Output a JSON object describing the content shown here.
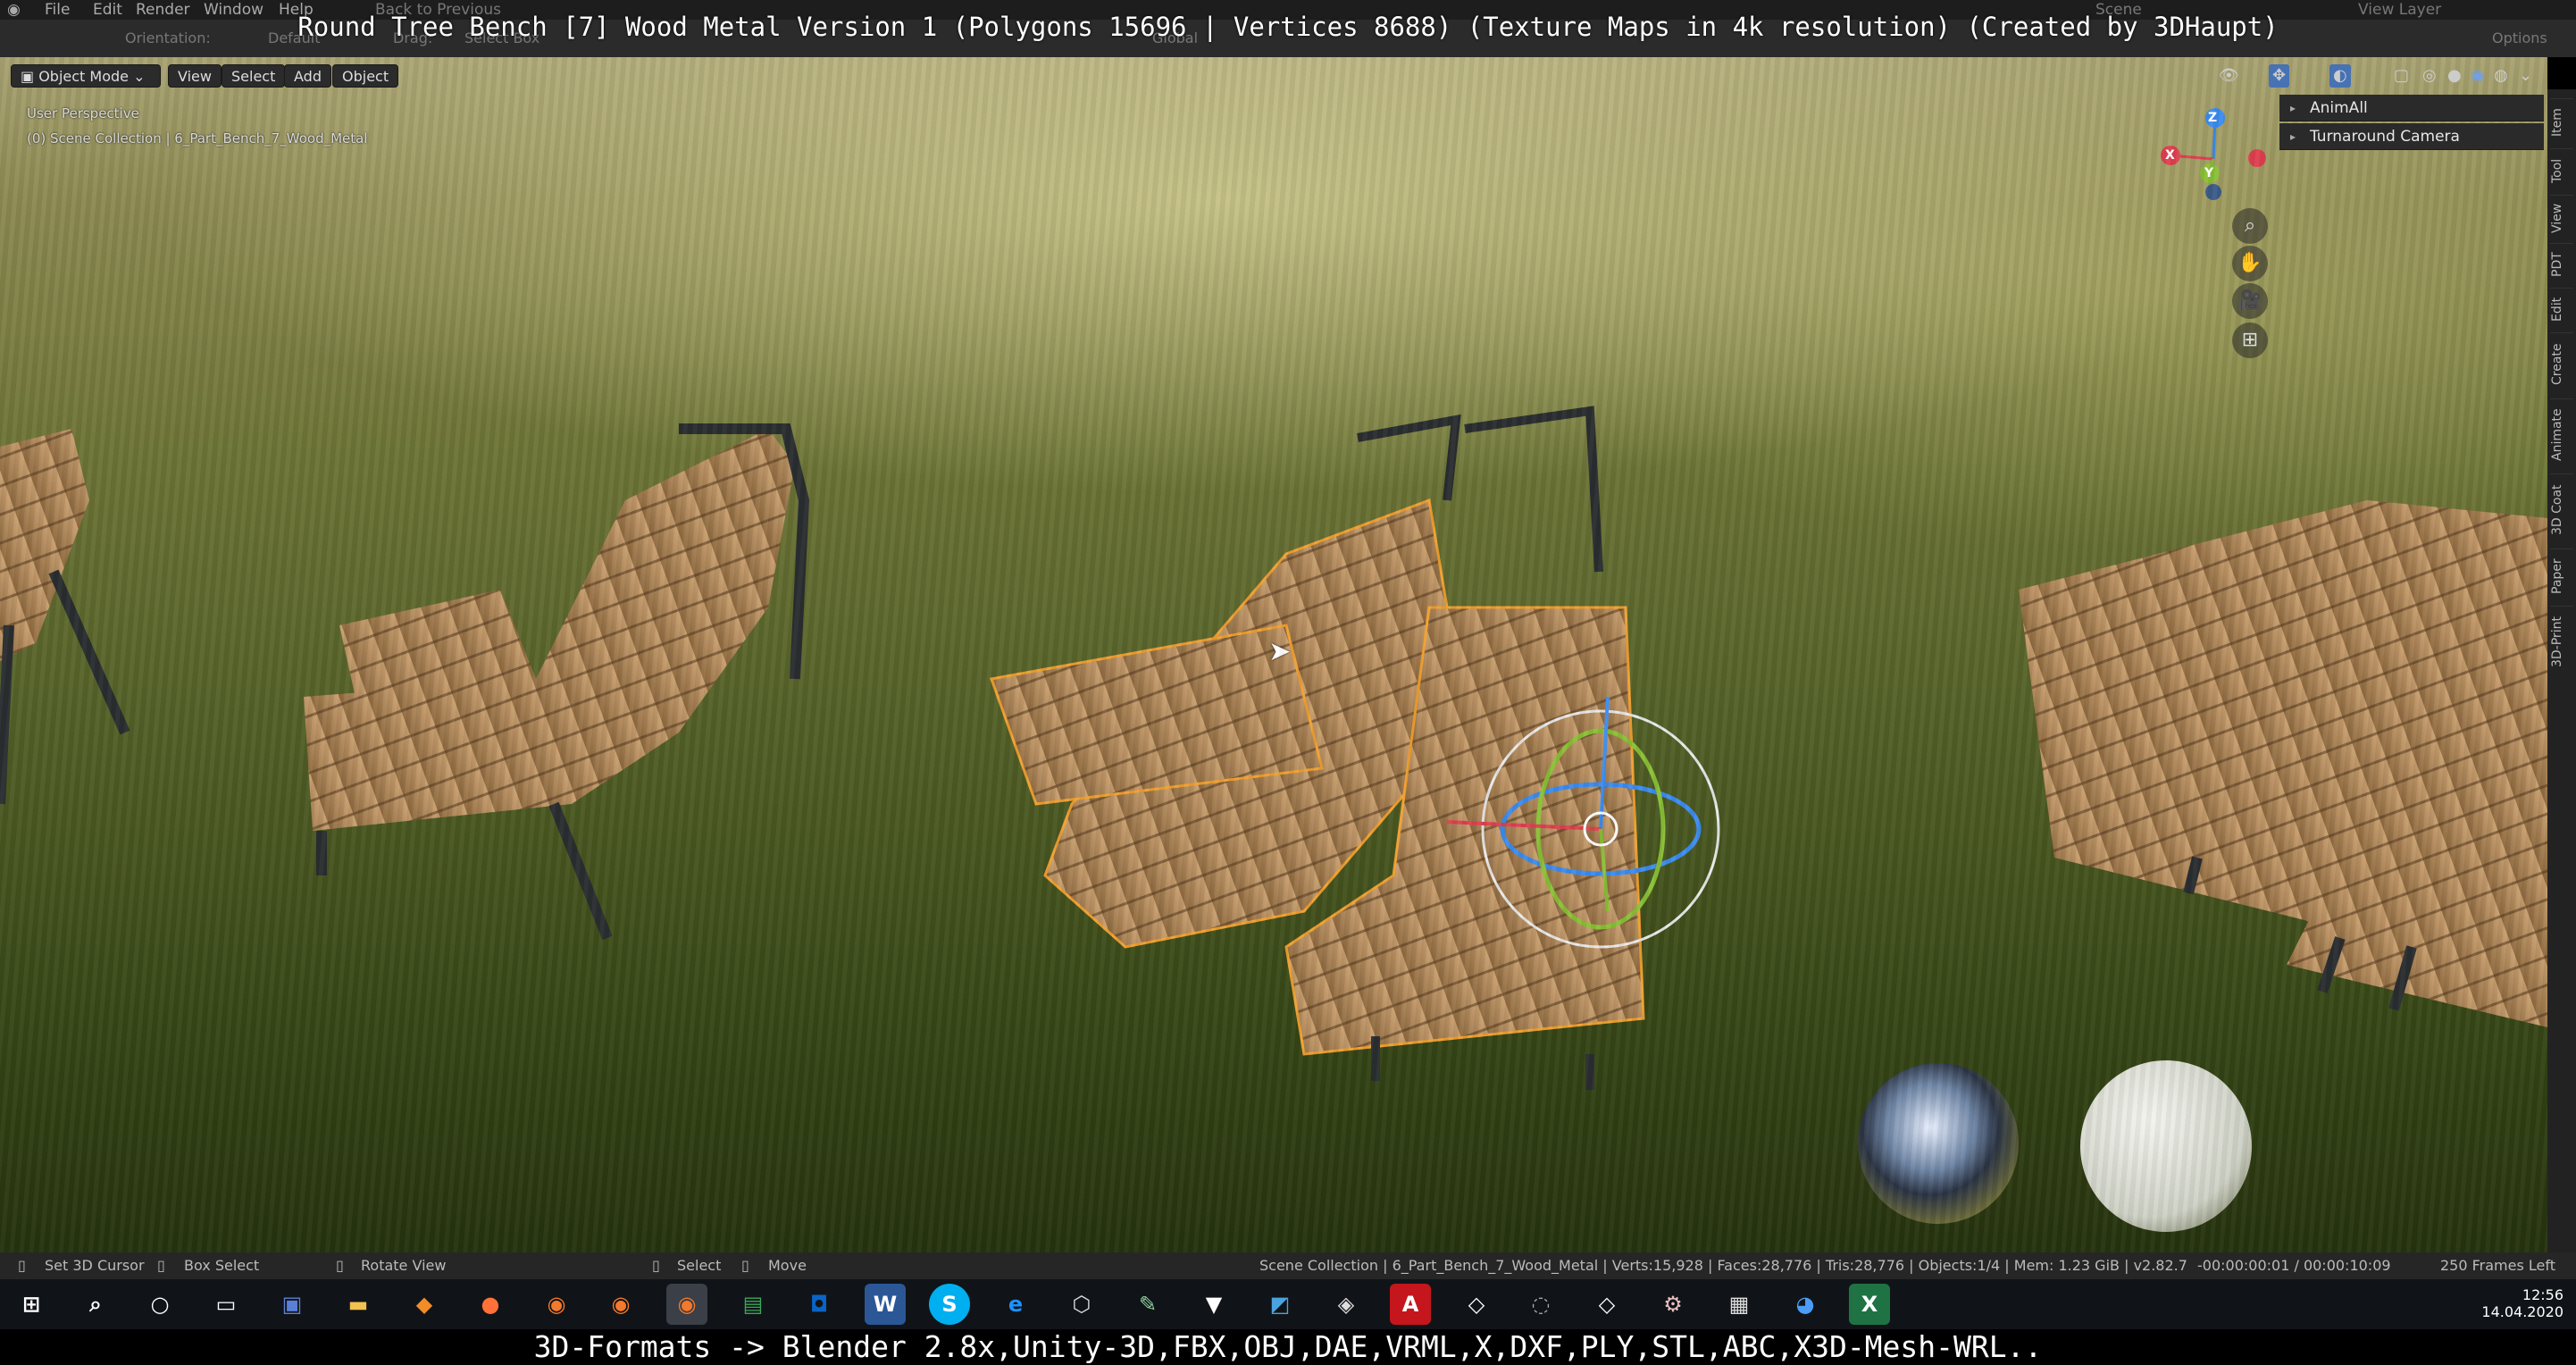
{
  "app": {
    "title_overlay": "Round Tree Bench [7] Wood Metal Version 1 (Polygons 15696 | Vertices 8688) (Texture Maps in 4k resolution) (Created by 3DHaupt)",
    "menu": [
      "File",
      "Edit",
      "Render",
      "Window",
      "Help"
    ],
    "back_to_previous": "Back to Previous",
    "scene_label": "Scene",
    "view_layer_label": "View Layer",
    "orientation_label": "Orientation:",
    "orientation_value": "Default",
    "drag_label": "Drag:",
    "drag_value": "Select Box",
    "transform_value": "Global",
    "options_label": "Options"
  },
  "header": {
    "mode": "Object Mode",
    "menus": [
      "View",
      "Select",
      "Add",
      "Object"
    ]
  },
  "viewport": {
    "perspective": "User Perspective",
    "collection": "(0) Scene Collection | 6_Part_Bench_7_Wood_Metal",
    "gizmo_axes": [
      "X",
      "Y",
      "Z"
    ]
  },
  "sidebar": {
    "panels": [
      "AnimAll",
      "Turnaround Camera"
    ],
    "tabs": [
      "Item",
      "Tool",
      "View",
      "PDT",
      "Edit",
      "Create",
      "Animate",
      "3D Coat",
      "Paper",
      "3D-Print"
    ]
  },
  "statusbar": {
    "set_cursor": "Set 3D Cursor",
    "box_select": "Box Select",
    "rotate_view": "Rotate View",
    "select": "Select",
    "move": "Move",
    "stats": "Scene Collection | 6_Part_Bench_7_Wood_Metal | Verts:15,928 | Faces:28,776 | Tris:28,776 | Objects:1/4 | Mem: 1.23 GiB | v2.82.7",
    "timecode": "-00:00:00:01 / 00:00:10:09",
    "frames_left": "250 Frames Left"
  },
  "taskbar": {
    "time": "12:56",
    "date": "14.04.2020",
    "apps": [
      "start",
      "search",
      "cortana",
      "task-view",
      "save",
      "explorer",
      "app-flame",
      "firefox",
      "blender-a",
      "blender-b",
      "blender-c",
      "sheets",
      "outlook",
      "word",
      "skype",
      "edge",
      "box3d",
      "pen",
      "vectr",
      "photo",
      "inkscape",
      "acrobat",
      "unity-a",
      "unity-b",
      "unity-c",
      "tool",
      "calculator",
      "maps",
      "excel"
    ],
    "app_letters": {
      "word": "W",
      "skype": "S",
      "edge": "e",
      "excel": "X",
      "acrobat": "A"
    }
  },
  "bottom_banner": "3D-Formats -> Blender 2.8x,Unity-3D,FBX,OBJ,DAE,VRML,X,DXF,PLY,STL,ABC,X3D-Mesh-WRL..",
  "colors": {
    "selection_outline": "#f0a030",
    "wood": "#b48a5a",
    "metal": "#2a2e30",
    "gizmo_x": "#e04050",
    "gizmo_y": "#8ac036",
    "gizmo_z": "#3c8cf0"
  }
}
